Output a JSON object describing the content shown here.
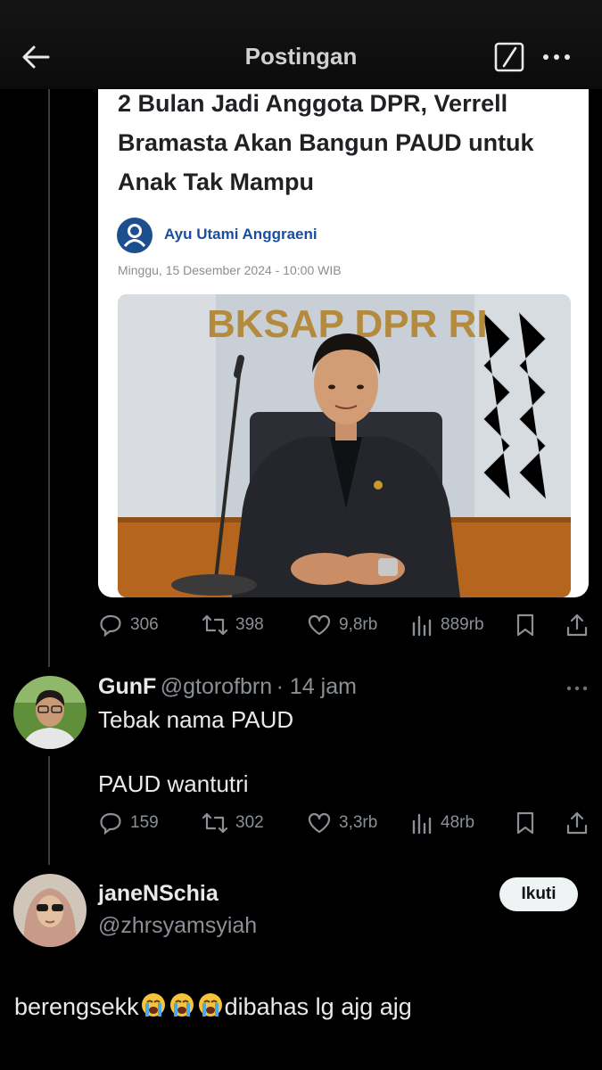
{
  "header": {
    "title": "Postingan",
    "back_icon": "arrow-left-icon",
    "edit_icon": "compose-icon",
    "more_icon": "more-icon"
  },
  "article": {
    "headline": "2 Bulan Jadi Anggota DPR, Verrell Bramasta Akan Bangun PAUD untuk Anak Tak Mampu",
    "author": "Ayu Utami Anggraeni",
    "date": "Minggu, 15 Desember 2024 - 10:00 WIB",
    "photo_sign": "BKSAP DPR RI"
  },
  "main_post_stats": {
    "replies": "306",
    "reposts": "398",
    "likes": "9,8rb",
    "views": "889rb"
  },
  "reply1": {
    "name": "GunF",
    "handle": "@gtorofbrn",
    "time": "· 14 jam",
    "line1": "Tebak nama PAUD",
    "line2": "PAUD wantutri",
    "stats": {
      "replies": "159",
      "reposts": "302",
      "likes": "3,3rb",
      "views": "48rb"
    }
  },
  "reply2": {
    "name": "janeNSchia",
    "handle": "@zhrsyamsyiah",
    "follow_label": "Ikuti",
    "text_before": "berengsekk",
    "text_after": "dibahas lg ajg ajg"
  },
  "colors": {
    "background": "#000000",
    "text": "#e7e9ea",
    "muted": "#8b9096",
    "link": "#1a4fa0"
  }
}
